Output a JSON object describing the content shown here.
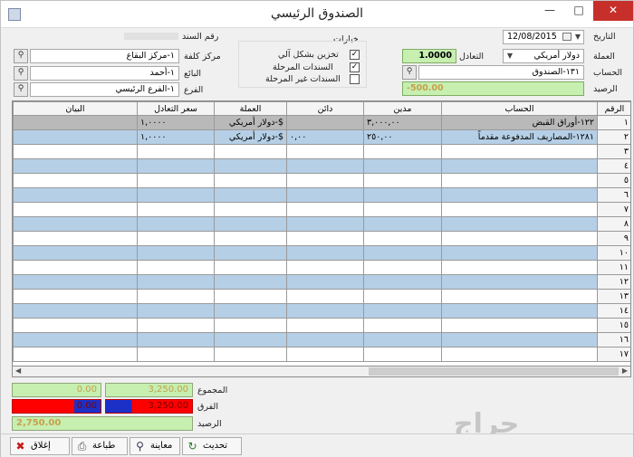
{
  "window": {
    "title": "الصندوق الرئيسي"
  },
  "header": {
    "date_label": "التاريخ",
    "date_value": "12/08/2015",
    "currency_label": "العملة",
    "currency_value": "دولار أمريكي",
    "rate_label": "التعادل",
    "rate_value": "1.0000",
    "account_label": "الحساب",
    "account_value": "١٣١-الصندوق",
    "balance_label": "الرصيد",
    "balance_value": "-500.00",
    "doc_number_label": "رقم السند",
    "options_label": "خيارات",
    "opt_auto_store": "تخزين بشكل آلي",
    "opt_posted": "السندات المرحلة",
    "opt_unposted": "السندات غير المرحلة",
    "cost_center_label": "مركز كلفة",
    "cost_center_value": "١-مركز البقاع",
    "seller_label": "البائع",
    "seller_value": "١-أحمد",
    "branch_label": "الفرع",
    "branch_value": "١-الفرع الرئيسي"
  },
  "grid": {
    "columns": [
      "الرقم",
      "الحساب",
      "مدين",
      "دائن",
      "العملة",
      "سعر التعادل",
      "البيان"
    ],
    "rows": [
      {
        "num": "١",
        "account": "١٢٢-أوراق القبض",
        "debit": "٣,٠٠٠,٠٠",
        "credit": "",
        "currency": "$-دولار أمريكي",
        "rate": "١,٠٠٠٠",
        "desc": ""
      },
      {
        "num": "٢",
        "account": "١٢٨١-المصاريف المدفوعة مقدماً",
        "debit": "٢٥٠,٠٠",
        "credit": "٠,٠٠",
        "currency": "$-دولار أمريكي",
        "rate": "١,٠٠٠٠",
        "desc": ""
      },
      {
        "num": "٣"
      },
      {
        "num": "٤"
      },
      {
        "num": "٥"
      },
      {
        "num": "٦"
      },
      {
        "num": "٧"
      },
      {
        "num": "٨"
      },
      {
        "num": "٩"
      },
      {
        "num": "١٠"
      },
      {
        "num": "١١"
      },
      {
        "num": "١٢"
      },
      {
        "num": "١٣"
      },
      {
        "num": "١٤"
      },
      {
        "num": "١٥"
      },
      {
        "num": "١٦"
      },
      {
        "num": "١٧"
      }
    ]
  },
  "totals": {
    "sum_label": "المجموع",
    "sum_debit": "3,250.00",
    "sum_credit": "0.00",
    "diff_label": "الفرق",
    "diff_debit": "3,250.00",
    "diff_credit": "0.00",
    "balance_label": "الرصيد",
    "balance_value": "2,750.00"
  },
  "toolbar": {
    "refresh": "تحديث",
    "preview": "معاينة",
    "print": "طباعة",
    "close": "إغلاق"
  },
  "watermark": "حراج"
}
